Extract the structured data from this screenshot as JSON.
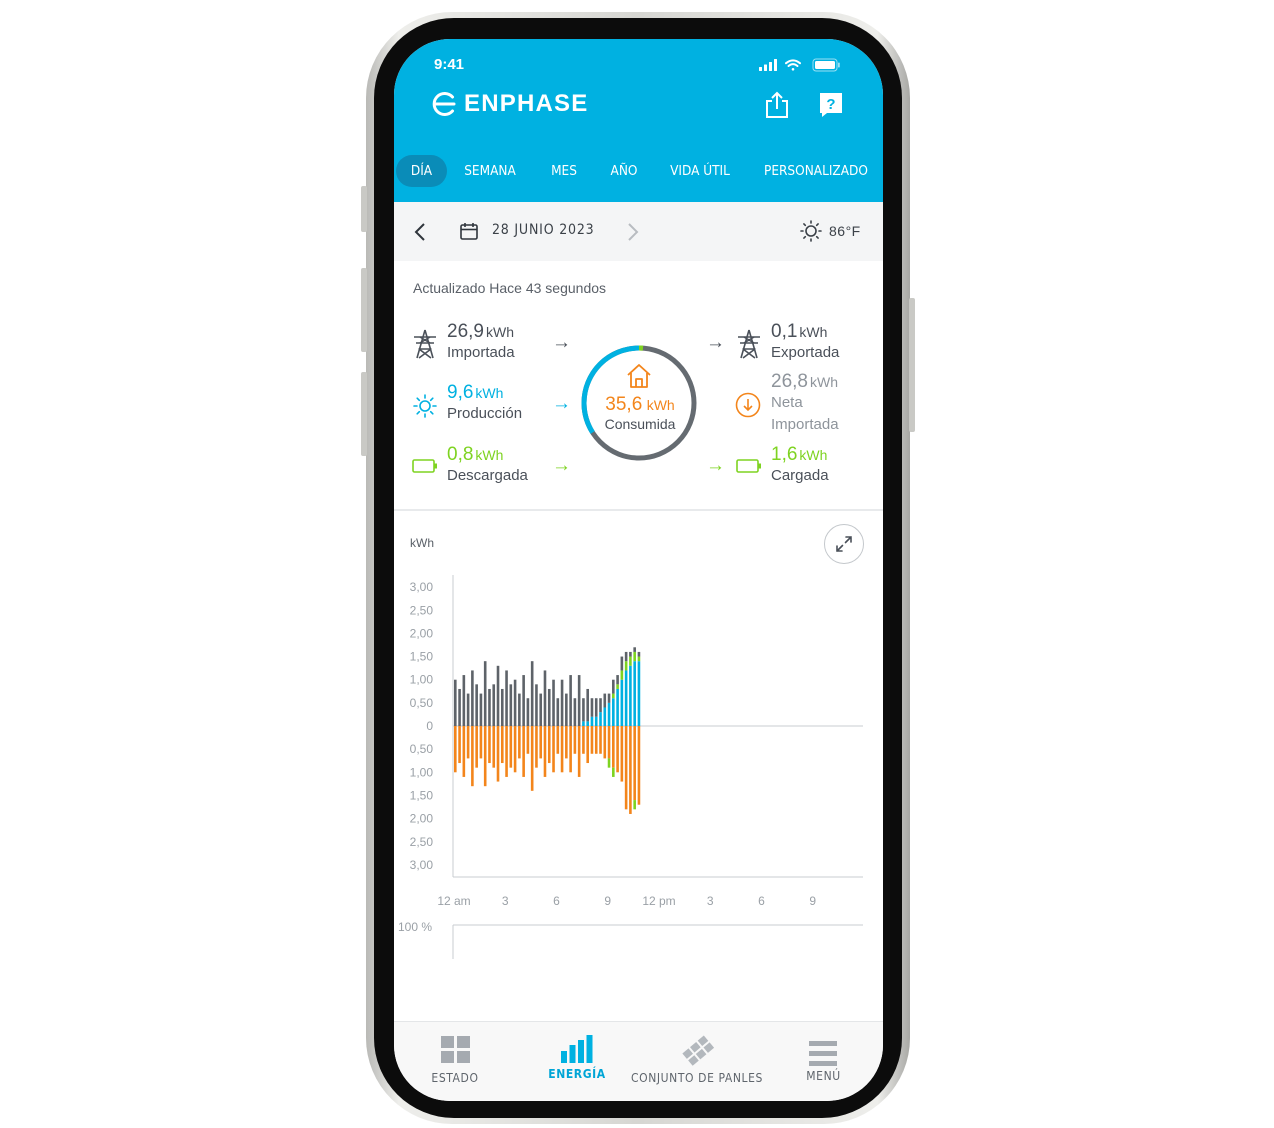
{
  "status_bar": {
    "time": "9:41"
  },
  "header": {
    "brand": "ENPHASE",
    "share_icon": "share-icon",
    "help_icon": "help-icon",
    "colors": {
      "header_bg": "#00b1e1",
      "active_tab_bg": "#0a8cb8"
    }
  },
  "tabs": [
    {
      "label": "DÍA",
      "active": true
    },
    {
      "label": "SEMANA",
      "active": false
    },
    {
      "label": "MES",
      "active": false
    },
    {
      "label": "AÑO",
      "active": false
    },
    {
      "label": "VIDA ÚTIL",
      "active": false
    },
    {
      "label": "PERSONALIZADO",
      "active": false
    }
  ],
  "date_bar": {
    "date": "28 JUNIO 2023",
    "temperature": "86°F",
    "weather_icon": "sun-icon"
  },
  "summary": {
    "updated": "Actualizado Hace 43 segundos",
    "imported": {
      "value": "26,9",
      "unit": "kWh",
      "label": "Importada"
    },
    "production": {
      "value": "9,6",
      "unit": "kWh",
      "label": "Producción"
    },
    "discharged": {
      "value": "0,8",
      "unit": "kWh",
      "label": "Descargada"
    },
    "consumed": {
      "value": "35,6",
      "unit": "kWh",
      "label": "Consumida"
    },
    "exported": {
      "value": "0,1",
      "unit": "kWh",
      "label": "Exportada"
    },
    "net_imported": {
      "value": "26,8",
      "unit": "kWh",
      "label_line1": "Neta",
      "label_line2": "Importada"
    },
    "charged": {
      "value": "1,6",
      "unit": "kWh",
      "label": "Cargada"
    },
    "colors": {
      "grid": "#4a5059",
      "solar": "#00b1e1",
      "battery": "#7ed321",
      "consumption": "#f3851b",
      "net": "#8e949b"
    }
  },
  "chart": {
    "unit_label": "kWh",
    "percent_label": "100 %",
    "expand_icon": "expand-icon"
  },
  "chart_data": {
    "type": "bar",
    "ylabel": "kWh",
    "y_tick_labels": [
      "3,00",
      "2,50",
      "2,00",
      "1,50",
      "1,00",
      "0,50",
      "0",
      "0,50",
      "1,00",
      "1,50",
      "2,00",
      "2,50",
      "3,00"
    ],
    "ylim": [
      -3.0,
      3.0
    ],
    "x_tick_labels": [
      "12 am",
      "3",
      "6",
      "9",
      "12 pm",
      "3",
      "6",
      "9"
    ],
    "x_range_hours": [
      0,
      24
    ],
    "interval_hours": 0.25,
    "series": [
      {
        "name": "Importada",
        "color": "#5e6369",
        "direction": "up",
        "values": [
          1.0,
          0.8,
          1.1,
          0.7,
          1.2,
          0.9,
          0.7,
          1.4,
          0.8,
          0.9,
          1.3,
          0.8,
          1.2,
          0.9,
          1.0,
          0.7,
          1.1,
          0.6,
          1.4,
          0.9,
          0.7,
          1.2,
          0.8,
          1.0,
          0.6,
          1.0,
          0.7,
          1.1,
          0.6,
          1.1,
          0.5,
          0.7,
          0.4,
          0.4,
          0.3,
          0.3,
          0.2,
          0.3,
          0.2,
          0.3,
          0.2,
          0.1,
          0.1,
          0.1
        ]
      },
      {
        "name": "Producción",
        "color": "#00b1e1",
        "direction": "up",
        "values": [
          0,
          0,
          0,
          0,
          0,
          0,
          0,
          0,
          0,
          0,
          0,
          0,
          0,
          0,
          0,
          0,
          0,
          0,
          0,
          0,
          0,
          0,
          0,
          0,
          0,
          0,
          0,
          0,
          0,
          0,
          0.1,
          0.1,
          0.2,
          0.2,
          0.3,
          0.4,
          0.5,
          0.6,
          0.8,
          1.0,
          1.2,
          1.3,
          1.4,
          1.4
        ]
      },
      {
        "name": "Descargada",
        "color": "#7ed321",
        "direction": "up",
        "values": [
          0,
          0,
          0,
          0,
          0,
          0,
          0,
          0,
          0,
          0,
          0,
          0,
          0,
          0,
          0,
          0,
          0,
          0,
          0,
          0,
          0,
          0,
          0,
          0,
          0,
          0,
          0,
          0,
          0,
          0,
          0,
          0,
          0,
          0,
          0,
          0,
          0,
          0.1,
          0.1,
          0.2,
          0.2,
          0.2,
          0.2,
          0.1
        ]
      },
      {
        "name": "Consumida",
        "color": "#f3851b",
        "direction": "down",
        "values": [
          1.0,
          0.8,
          1.1,
          0.7,
          1.3,
          0.9,
          0.7,
          1.3,
          0.8,
          0.9,
          1.2,
          0.8,
          1.1,
          0.9,
          1.0,
          0.7,
          1.1,
          0.6,
          1.4,
          0.9,
          0.7,
          1.1,
          0.8,
          1.0,
          0.6,
          1.0,
          0.7,
          1.0,
          0.6,
          1.1,
          0.6,
          0.8,
          0.6,
          0.6,
          0.6,
          0.7,
          0.7,
          0.9,
          1.0,
          1.2,
          1.8,
          1.9,
          1.6,
          1.7
        ]
      },
      {
        "name": "Cargada",
        "color": "#7ed321",
        "direction": "down",
        "values": [
          0,
          0,
          0,
          0,
          0,
          0,
          0,
          0,
          0,
          0,
          0,
          0,
          0,
          0,
          0,
          0,
          0,
          0,
          0,
          0,
          0,
          0,
          0,
          0,
          0,
          0,
          0,
          0,
          0,
          0,
          0,
          0,
          0,
          0,
          0,
          0,
          0.2,
          0.2,
          0,
          0,
          0,
          0,
          0.2,
          0
        ]
      }
    ]
  },
  "bottom_nav": [
    {
      "label": "ESTADO",
      "icon": "grid-icon",
      "active": false
    },
    {
      "label": "ENERGÍA",
      "icon": "bar-chart-icon",
      "active": true
    },
    {
      "label": "CONJUNTO DE PANLES",
      "icon": "solar-panel-icon",
      "active": false
    },
    {
      "label": "MENÚ",
      "icon": "menu-icon",
      "active": false
    }
  ]
}
